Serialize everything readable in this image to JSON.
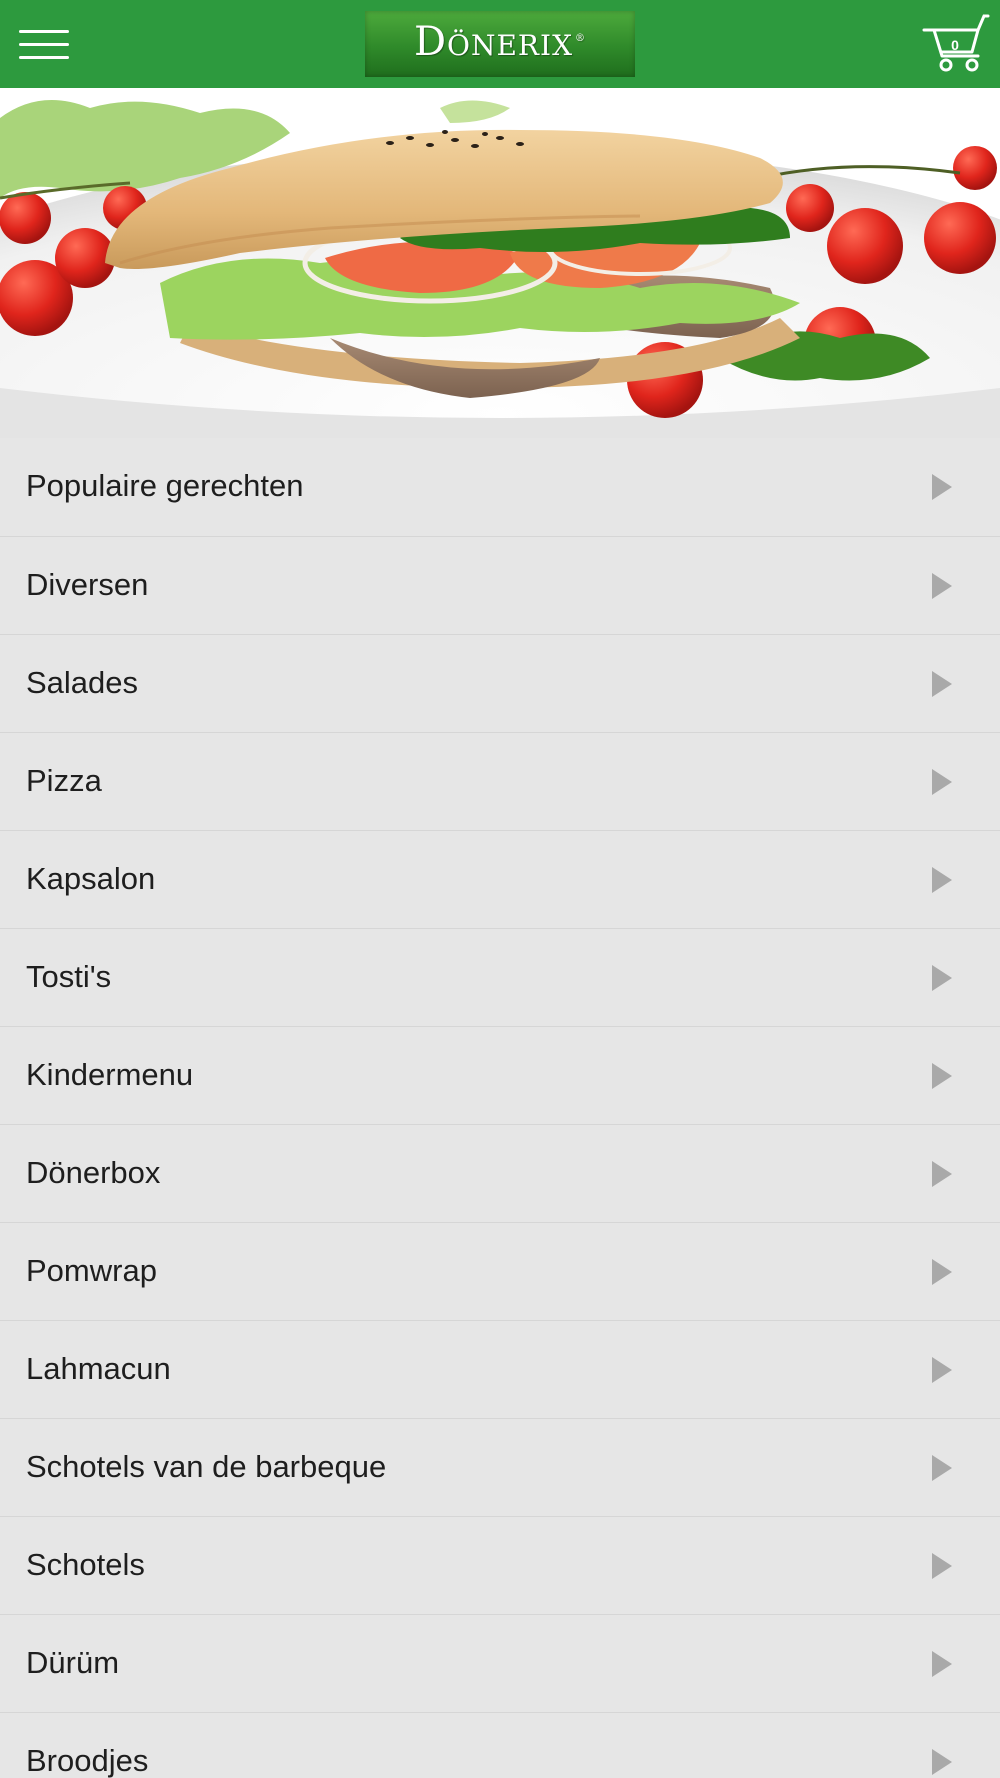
{
  "header": {
    "logo_text": "Dönerix",
    "logo_reg": "®",
    "cart_count": "0"
  },
  "colors": {
    "header_bg": "#2d9a3e",
    "list_bg": "#e6e6e6",
    "chevron": "#a9a9a9"
  },
  "icons": {
    "menu": "hamburger-icon",
    "cart": "shopping-cart-icon",
    "row": "chevron-right-icon"
  },
  "categories": [
    {
      "label": "Populaire gerechten"
    },
    {
      "label": "Diversen"
    },
    {
      "label": "Salades"
    },
    {
      "label": "Pizza"
    },
    {
      "label": "Kapsalon"
    },
    {
      "label": "Tosti's"
    },
    {
      "label": "Kindermenu"
    },
    {
      "label": "Dönerbox"
    },
    {
      "label": "Pomwrap"
    },
    {
      "label": "Lahmacun"
    },
    {
      "label": "Schotels van de barbeque"
    },
    {
      "label": "Schotels"
    },
    {
      "label": "Dürüm"
    },
    {
      "label": "Broodjes"
    }
  ]
}
